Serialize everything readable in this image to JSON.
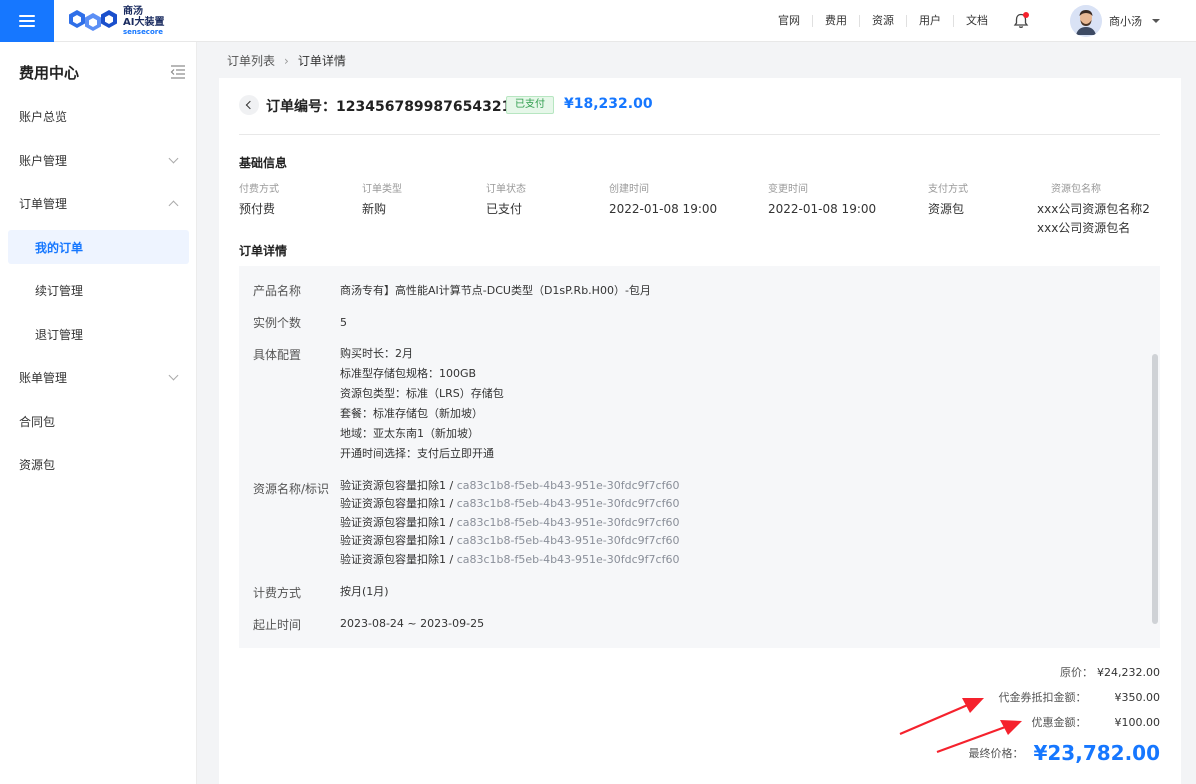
{
  "header": {
    "logo": {
      "line1": "商汤",
      "line2": "AI大装置",
      "line3": "sensecore"
    },
    "nav": [
      "官网",
      "费用",
      "资源",
      "用户",
      "文档"
    ],
    "user_name": "商小汤"
  },
  "sidebar": {
    "title": "费用中心",
    "items": [
      {
        "label": "账户总览"
      },
      {
        "label": "账户管理"
      },
      {
        "label": "订单管理"
      },
      {
        "label": "我的订单"
      },
      {
        "label": "续订管理"
      },
      {
        "label": "退订管理"
      },
      {
        "label": "账单管理"
      },
      {
        "label": "合同包"
      },
      {
        "label": "资源包"
      }
    ]
  },
  "breadcrumb": [
    "订单列表",
    "订单详情"
  ],
  "order": {
    "title": "订单编号：123456789987654321",
    "status_badge": "已支付",
    "amount": "¥18,232.00"
  },
  "basic_info": {
    "title": "基础信息",
    "fields": [
      {
        "label": "付费方式",
        "value": "预付费"
      },
      {
        "label": "订单类型",
        "value": "新购"
      },
      {
        "label": "订单状态",
        "value": "已支付"
      },
      {
        "label": "创建时间",
        "value": "2022-01-08 19:00"
      },
      {
        "label": "变更时间",
        "value": "2022-01-08 19:00"
      },
      {
        "label": "支付方式",
        "value": "资源包"
      },
      {
        "label": "资源包名称",
        "value": [
          "xxx公司资源包名称2",
          "xxx公司资源包名"
        ]
      }
    ]
  },
  "order_detail": {
    "title": "订单详情",
    "product_label": "产品名称",
    "product_value": "商汤专有】高性能AI计算节点-DCU类型（D1sP.Rb.H00）-包月",
    "instances_label": "实例个数",
    "instances_value": "5",
    "config_label": "具体配置",
    "config_lines": [
      "购买时长：2月",
      "标准型存储包规格：100GB",
      "资源包类型：标准（LRS）存储包",
      "套餐：标准存储包（新加坡）",
      "地域：亚太东南1（新加坡）",
      "开通时间选择：支付后立即开通"
    ],
    "resource_label": "资源名称/标识",
    "resources": [
      {
        "name": "验证资源包容量扣除1 / ",
        "id": "ca83c1b8-f5eb-4b43-951e-30fdc9f7cf60"
      },
      {
        "name": "验证资源包容量扣除1 / ",
        "id": "ca83c1b8-f5eb-4b43-951e-30fdc9f7cf60"
      },
      {
        "name": "验证资源包容量扣除1 / ",
        "id": "ca83c1b8-f5eb-4b43-951e-30fdc9f7cf60"
      },
      {
        "name": "验证资源包容量扣除1 / ",
        "id": "ca83c1b8-f5eb-4b43-951e-30fdc9f7cf60"
      },
      {
        "name": "验证资源包容量扣除1 / ",
        "id": "ca83c1b8-f5eb-4b43-951e-30fdc9f7cf60"
      }
    ],
    "billing_label": "计费方式",
    "billing_value": "按月(1月)",
    "period_label": "起止时间",
    "period_value": "2023-08-24 ~ 2023-09-25"
  },
  "pricing": {
    "original_label": "原价：",
    "original_value": "¥24,232.00",
    "voucher_label": "代金券抵扣金额：",
    "voucher_value": "¥350.00",
    "discount_label": "优惠金额：",
    "discount_value": "¥100.00",
    "final_label": "最终价格：",
    "final_value": "¥23,782.00"
  },
  "colors": {
    "primary": "#1677ff",
    "paid_badge_bg": "#e6f7e9",
    "paid_badge_text": "#2e9d4c",
    "annotation_arrow": "#f5222d"
  }
}
